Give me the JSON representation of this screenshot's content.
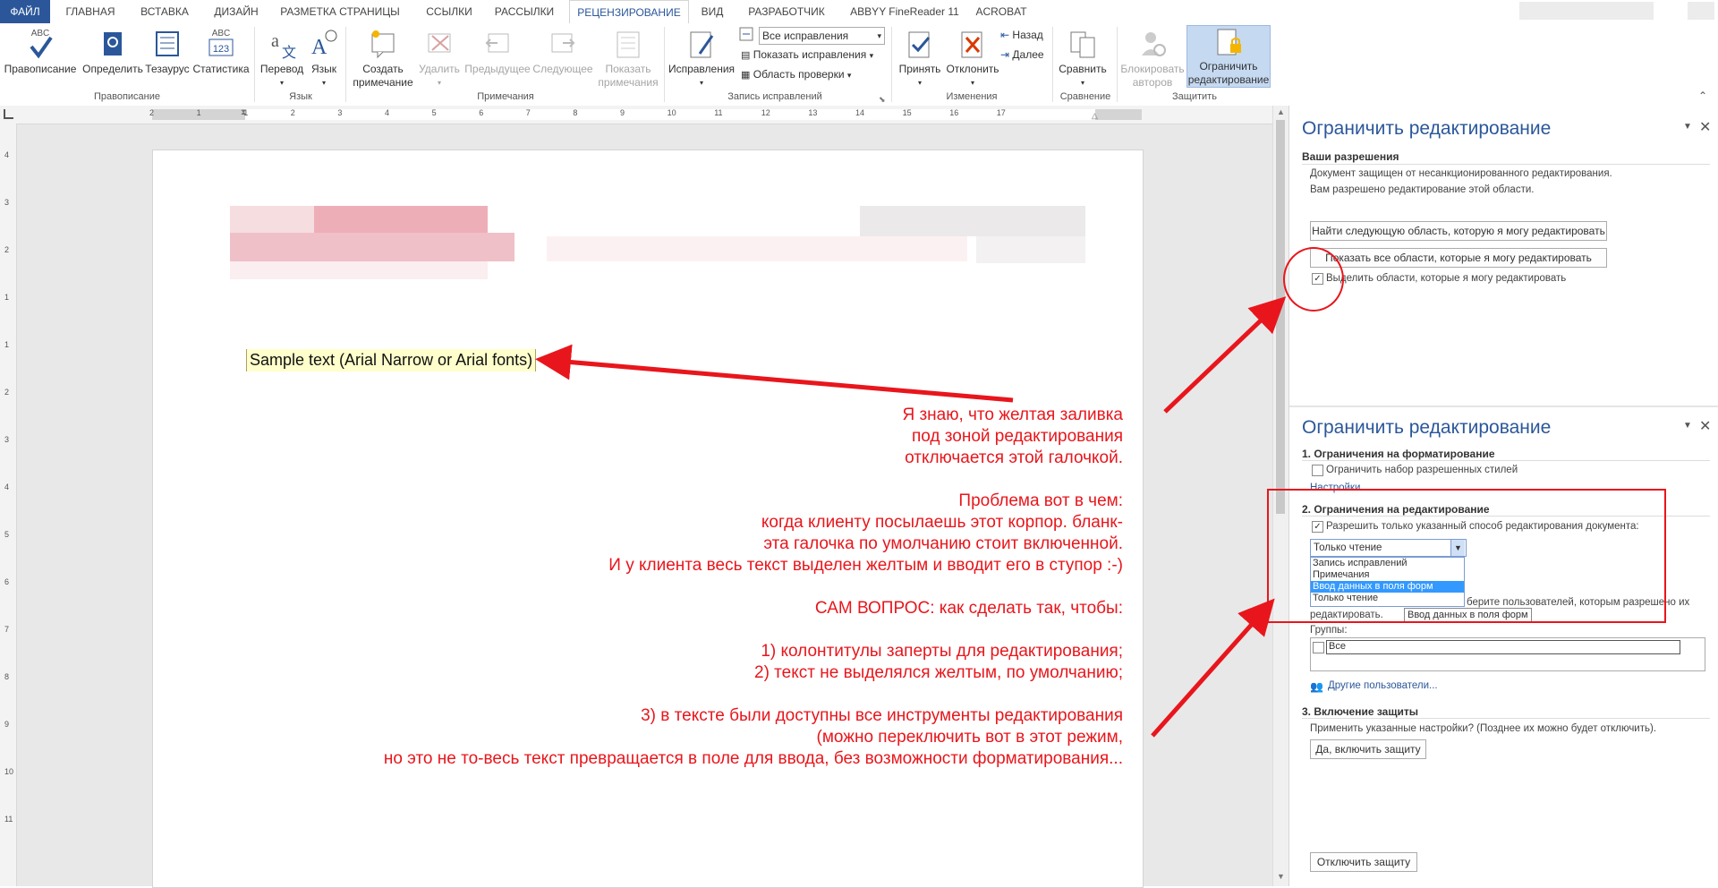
{
  "tabs": [
    "ФАЙЛ",
    "ГЛАВНАЯ",
    "ВСТАВКА",
    "ДИЗАЙН",
    "РАЗМЕТКА СТРАНИЦЫ",
    "ССЫЛКИ",
    "РАССЫЛКИ",
    "РЕЦЕНЗИРОВАНИЕ",
    "ВИД",
    "РАЗРАБОТЧИК",
    "ABBYY FineReader 11",
    "ACROBAT"
  ],
  "ribbon": {
    "proofing": {
      "spelling": "Правописание",
      "define": "Определить",
      "thesaurus": "Тезаурус",
      "stats": "Статистика",
      "group": "Правописание"
    },
    "language": {
      "translate": "Перевод",
      "language": "Язык",
      "group": "Язык"
    },
    "comments": {
      "new_line1": "Создать",
      "new_line2": "примечание",
      "delete": "Удалить",
      "prev": "Предыдущее",
      "next": "Следующее",
      "show_line1": "Показать",
      "show_line2": "примечания",
      "group": "Примечания"
    },
    "tracking": {
      "track": "Исправления",
      "dropdown_value": "Все исправления",
      "show_markup": "Показать исправления",
      "review_pane": "Область проверки",
      "group": "Запись исправлений"
    },
    "changes": {
      "accept": "Принять",
      "reject": "Отклонить",
      "back": "Назад",
      "forward": "Далее",
      "group": "Изменения"
    },
    "compare": {
      "compare": "Сравнить",
      "group": "Сравнение"
    },
    "protect": {
      "block_line1": "Блокировать",
      "block_line2": "авторов",
      "restrict_line1": "Ограничить",
      "restrict_line2": "редактирование",
      "group": "Защитить"
    },
    "icon_texts": {
      "abc": "ABC",
      "abc123_top": "ABC",
      "abc123_bottom": "123"
    }
  },
  "ruler_numbers": [
    "2",
    "1",
    "1",
    "2",
    "3",
    "4",
    "5",
    "6",
    "7",
    "8",
    "9",
    "10",
    "11",
    "12",
    "13",
    "14",
    "15",
    "16",
    "17"
  ],
  "ruler_v_numbers": [
    "4",
    "3",
    "2",
    "1",
    "1",
    "2",
    "3",
    "4",
    "5",
    "6",
    "7",
    "8",
    "9",
    "10",
    "11"
  ],
  "document": {
    "sample_text": "Sample text (Arial Narrow or Arial fonts)",
    "note1": [
      "Я знаю, что желтая заливка",
      "под зоной редактирования",
      "отключается этой галочкой."
    ],
    "note2": [
      "Проблема вот в чем:",
      "когда клиенту посылаешь этот корпор. бланк-",
      "эта галочка по умолчанию стоит включенной.",
      "И у клиента весь текст выделен желтым и вводит его в ступор :-)"
    ],
    "note3": "САМ ВОПРОС: как сделать так, чтобы:",
    "note4": [
      "1) колонтитулы заперты для редактирования;",
      "2) текст не выделялся желтым, по умолчанию;"
    ],
    "note5": [
      "3) в тексте были доступны все инструменты редактирования",
      "(можно переключить вот в этот режим,",
      "но это не то-весь текст превращается в поле для ввода, без возможности форматирования..."
    ]
  },
  "pane_top": {
    "title": "Ограничить редактирование",
    "permissions_heading": "Ваши разрешения",
    "line1": "Документ защищен от несанкционированного редактирования.",
    "line2": "Вам разрешено редактирование этой области.",
    "find_next_button": "Найти следующую область, которую я могу редактировать",
    "show_all_button": "Показать все области, которые я могу редактировать",
    "highlight_checkbox": "Выделить области, которые я могу редактировать"
  },
  "pane_bottom": {
    "title": "Ограничить редактирование",
    "section1": "1. Ограничения на форматирование",
    "limit_styles": "Ограничить набор разрешенных стилей",
    "settings_link": "Настройки...",
    "section2": "2. Ограничения на редактирование",
    "allow_only": "Разрешить только указанный способ редактирования документа:",
    "select_value": "Только чтение",
    "options": [
      "Запись исправлений",
      "Примечания",
      "Ввод данных в поля форм",
      "Только чтение"
    ],
    "tooltip": "Ввод данных в поля форм",
    "hidden_text_a": "берите пользователей, которым разрешено их",
    "hidden_text_b": "редактировать.",
    "groups_label": "Группы:",
    "everyone": "Все",
    "more_users": "Другие пользователи...",
    "section3": "3. Включение защиты",
    "apply_question": "Применить указанные настройки? (Позднее их можно будет отключить).",
    "enforce_button": "Да, включить защиту",
    "stop_button": "Отключить защиту"
  },
  "colors": {
    "accent": "#2b579a",
    "annotation_red": "#e8161c",
    "highlight_yellow": "#ffffcc"
  }
}
